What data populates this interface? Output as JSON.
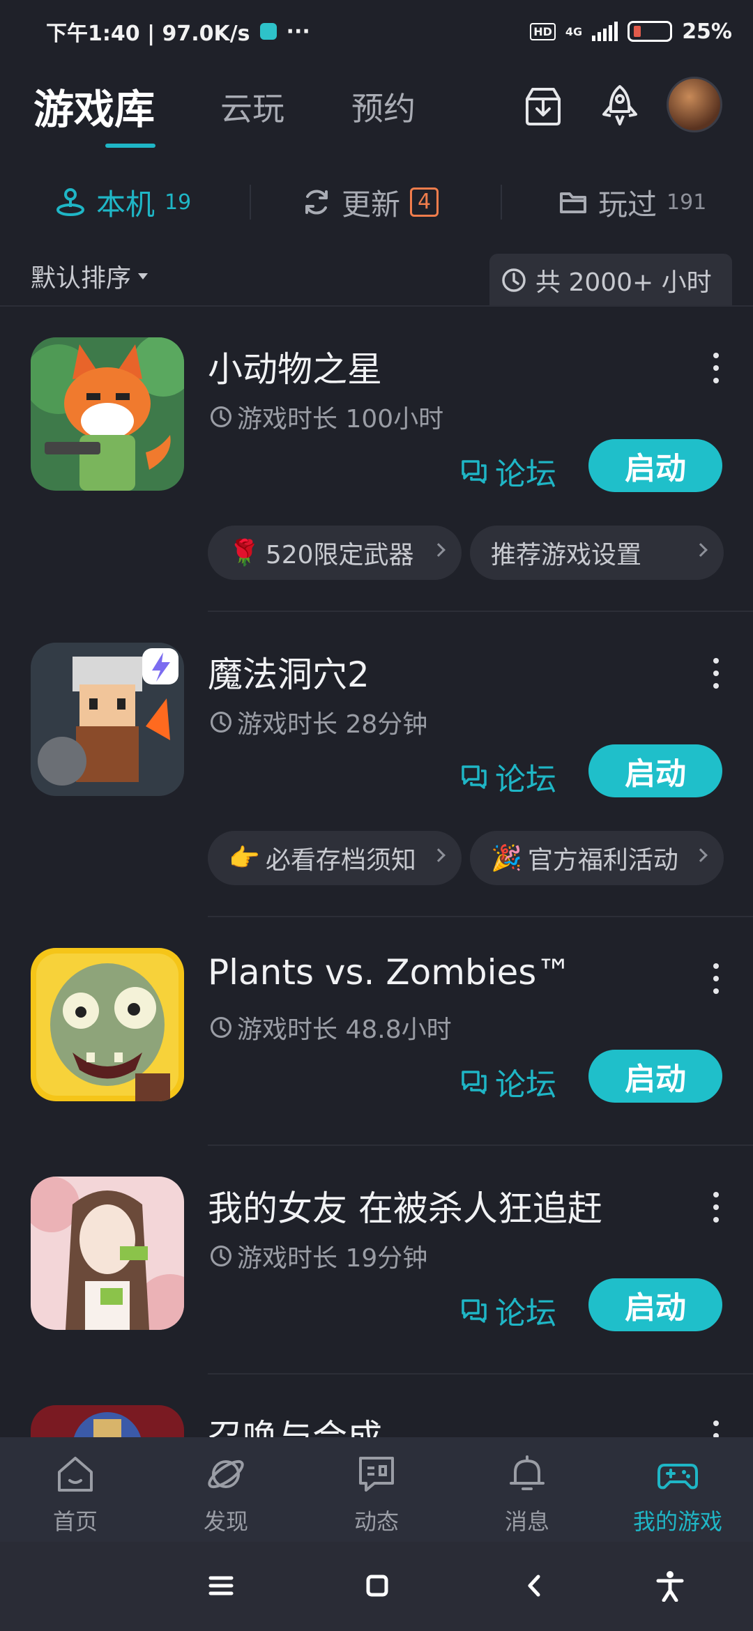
{
  "status_bar": {
    "time_speed": "下午1:40 | 97.0K/s",
    "dots": "···",
    "hd": "HD",
    "network": "4G",
    "battery": "25%"
  },
  "header": {
    "tabs": [
      {
        "label": "游戏库",
        "active": true
      },
      {
        "label": "云玩",
        "active": false
      },
      {
        "label": "预约",
        "active": false
      }
    ]
  },
  "filters": {
    "local": {
      "label": "本机",
      "count": "19"
    },
    "update": {
      "label": "更新",
      "count": "4"
    },
    "played": {
      "label": "玩过",
      "count": "191"
    }
  },
  "sort": {
    "label": "默认排序"
  },
  "total_time": "共 2000+ 小时",
  "games": [
    {
      "title": "小动物之星",
      "playtime": "游戏时长 100小时",
      "forum_label": "论坛",
      "launch_label": "启动",
      "chips": [
        {
          "emoji": "🌹",
          "label": "520限定武器"
        },
        {
          "emoji": "",
          "label": "推荐游戏设置"
        }
      ]
    },
    {
      "title": "魔法洞穴2",
      "playtime": "游戏时长 28分钟",
      "forum_label": "论坛",
      "launch_label": "启动",
      "chips": [
        {
          "emoji": "👉",
          "label": "必看存档须知"
        },
        {
          "emoji": "🎉",
          "label": "官方福利活动"
        }
      ]
    },
    {
      "title": "Plants vs. Zombies™",
      "playtime": "游戏时长 48.8小时",
      "forum_label": "论坛",
      "launch_label": "启动"
    },
    {
      "title": "我的女友 在被杀人狂追赶",
      "playtime": "游戏时长 19分钟",
      "forum_label": "论坛",
      "launch_label": "启动"
    },
    {
      "title": "召唤与合成"
    }
  ],
  "bottom_nav": [
    {
      "label": "首页",
      "icon": "home-icon",
      "active": false
    },
    {
      "label": "发现",
      "icon": "discover-icon",
      "active": false
    },
    {
      "label": "动态",
      "icon": "feed-icon",
      "active": false
    },
    {
      "label": "消息",
      "icon": "bell-icon",
      "active": false
    },
    {
      "label": "我的游戏",
      "icon": "gamepad-icon",
      "active": true
    }
  ],
  "colors": {
    "accent": "#1fb6c6",
    "background": "#1f2129",
    "badge": "#f07d4c"
  }
}
